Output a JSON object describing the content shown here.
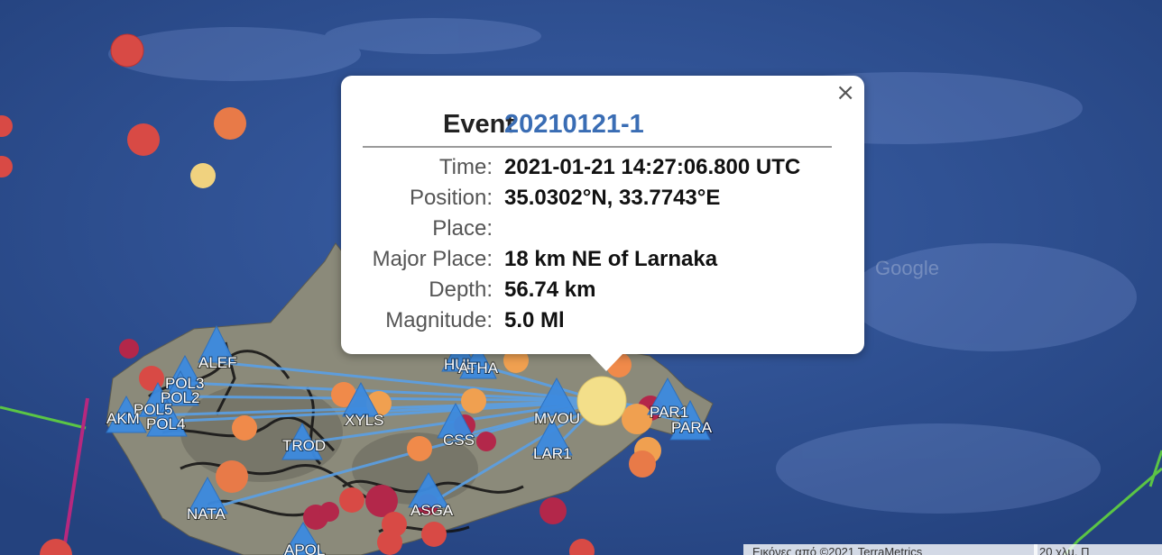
{
  "popup": {
    "event_label": "Event",
    "event_id": "20210121-1",
    "close_symbol": "×",
    "fields": [
      {
        "label": "Time:",
        "value": "2021-01-21 14:27:06.800 UTC"
      },
      {
        "label": "Position:",
        "value": "35.0302°N, 33.7743°E"
      },
      {
        "label": "Place:",
        "value": ""
      },
      {
        "label": "Major Place:",
        "value": "18 km NE of Larnaka"
      },
      {
        "label": "Depth:",
        "value": "56.74 km"
      },
      {
        "label": "Magnitude:",
        "value": "5.0 Ml"
      }
    ]
  },
  "stations": [
    "ALEF",
    "POL3",
    "POL2",
    "POL5",
    "AKM",
    "POL4",
    "XYLS",
    "TROD",
    "HUL",
    "ATHA",
    "CSS",
    "MVOU",
    "LAR1",
    "PAR1",
    "PARA",
    "NATA",
    "ASGA",
    "APOL"
  ],
  "map": {
    "watermark": "Google",
    "attribution": "Εικόνες από ©2021 TerraMetrics",
    "scale": "20 χλμ. Π",
    "colors": {
      "sea": "#2c4f92",
      "land": "#8a8a78",
      "station": "#3d8be0",
      "link": "#5aa0e6",
      "event_selected": "#f3df8a"
    }
  }
}
